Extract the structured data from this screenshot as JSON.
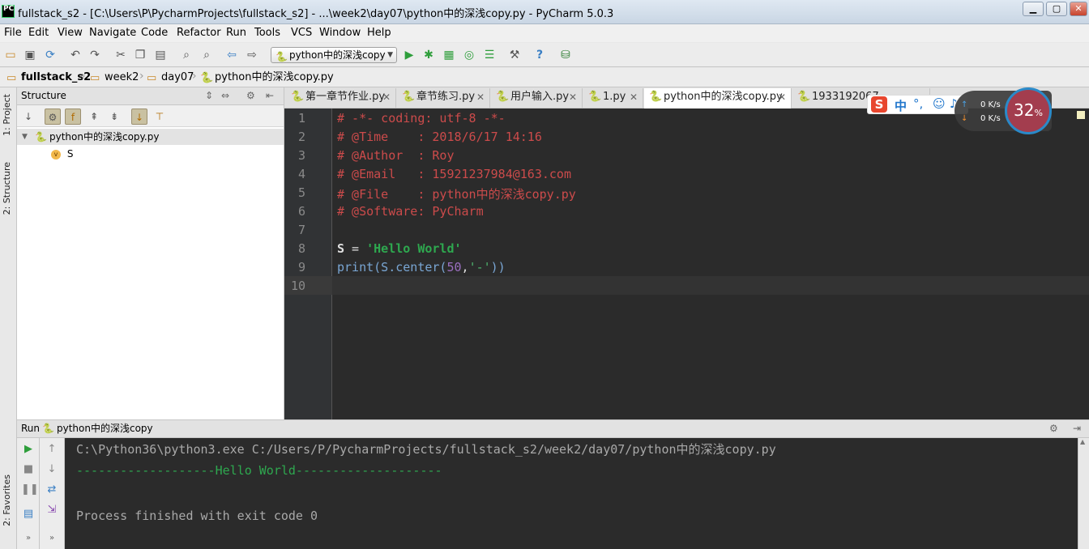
{
  "window": {
    "app_icon": "PC",
    "title": "fullstack_s2 - [C:\\Users\\P\\PycharmProjects\\fullstack_s2] - ...\\week2\\day07\\python中的深浅copy.py - PyCharm 5.0.3"
  },
  "menu": [
    "File",
    "Edit",
    "View",
    "Navigate",
    "Code",
    "Refactor",
    "Run",
    "Tools",
    "VCS",
    "Window",
    "Help"
  ],
  "toolbar": {
    "run_config": "python中的深浅copy",
    "help_icon": "?"
  },
  "breadcrumbs": [
    "fullstack_s2",
    "week2",
    "day07",
    "python中的深浅copy.py"
  ],
  "left_strip": {
    "project_tab": "1: Project",
    "structure_tab": "2: Structure",
    "favorites_tab": "2: Favorites"
  },
  "structure": {
    "title": "Structure",
    "root": "python中的深浅copy.py",
    "child": "S",
    "child_badge": "v"
  },
  "tabs": [
    {
      "label": "第一章节作业.py"
    },
    {
      "label": "章节练习.py"
    },
    {
      "label": "用户输入.py"
    },
    {
      "label": "1.py"
    },
    {
      "label": "python中的深浅copy.py",
      "active": true
    },
    {
      "label": "1933192067"
    }
  ],
  "editor": {
    "line_numbers": [
      "1",
      "2",
      "3",
      "4",
      "5",
      "6",
      "7",
      "8",
      "9",
      "10"
    ],
    "lines": {
      "l1": "# -*- coding: utf-8 -*-",
      "l2": "# @Time    : 2018/6/17 14:16",
      "l3": "# @Author  : Roy",
      "l4": "# @Email   : 1592123798​4@163.com",
      "l5": "# @File    : python中的深浅copy.py",
      "l6": "# @Software: PyCharm",
      "l8_var": "S",
      "l8_eq": " = ",
      "l8_str": "'Hello World'",
      "l9_fn": "print",
      "l9_call": "(S.center(",
      "l9_num": "50",
      "l9_comma": ",",
      "l9_str": "'-'",
      "l9_end": "))"
    }
  },
  "overlay": {
    "ime_logo": "S",
    "ime_lang": "中",
    "ime_punct": "°,",
    "net_up": "0 K/s",
    "net_down": "0 K/s",
    "cpu_percent": "32",
    "cpu_unit": "%"
  },
  "run": {
    "label": "Run",
    "config": "python中的深浅copy",
    "console": [
      "C:\\Python36\\python3.exe C:/Users/P/PycharmProjects/fullstack_s2/week2/day07/python中的深浅copy.py",
      "-------------------Hello World--------------------",
      "",
      "Process finished with exit code 0"
    ]
  },
  "colors": {
    "editor_bg": "#2b2b2b",
    "comment": "#cc4b4b",
    "string": "#2ea84f",
    "keyword": "#79a6d4"
  }
}
